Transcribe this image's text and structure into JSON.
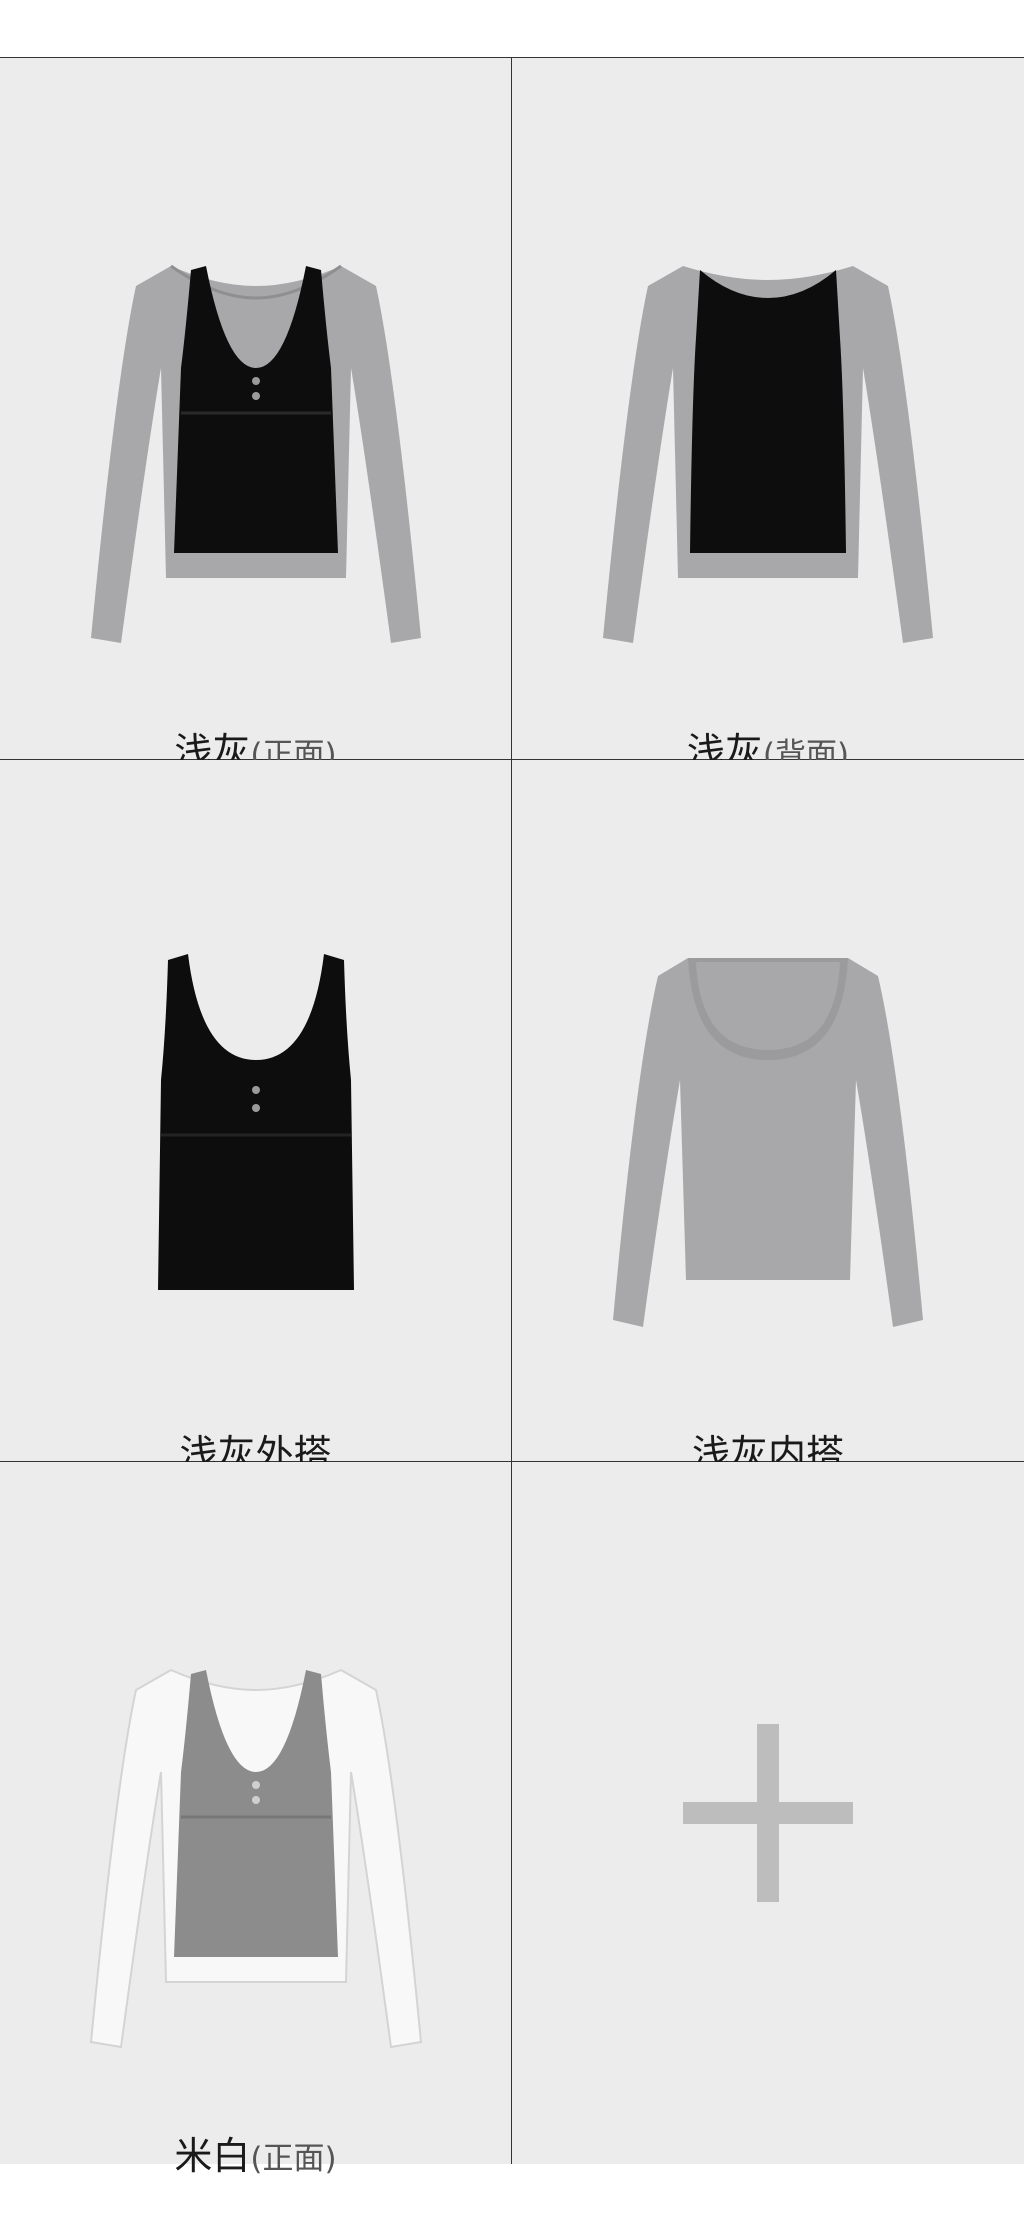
{
  "items": [
    {
      "color": "浅灰",
      "view": "(正面)"
    },
    {
      "color": "浅灰",
      "view": "(背面)"
    },
    {
      "label": "浅灰外搭"
    },
    {
      "label": "浅灰内搭"
    },
    {
      "color": "米白",
      "view": "(正面)"
    }
  ],
  "add_tile": {
    "icon": "plus-icon"
  },
  "colors": {
    "tile_bg": "#ececec",
    "grid_line": "#333333",
    "light_gray_garment": "#a8a8aa",
    "black_garment": "#0d0d0d",
    "heather_gray_garment": "#8c8c8c",
    "off_white_garment": "#f8f8f8",
    "plus_icon": "#bdbdbd"
  }
}
